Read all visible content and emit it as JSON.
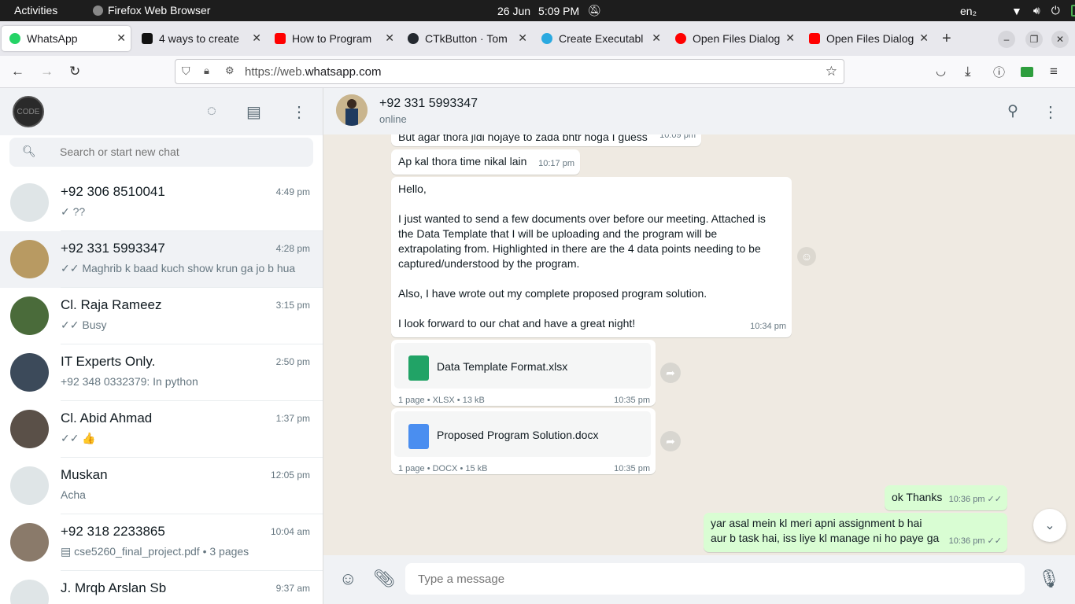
{
  "os": {
    "activities": "Activities",
    "app_name": "Firefox Web Browser",
    "date": "26 Jun",
    "time": "5:09 PM",
    "keyboard": "en₂"
  },
  "tabs": [
    {
      "title": "WhatsApp",
      "color": "#25d366"
    },
    {
      "title": "4 ways to create",
      "color": "#111111"
    },
    {
      "title": "How to Program",
      "color": "#ff0000"
    },
    {
      "title": "CTkButton · Tom",
      "color": "#24292f"
    },
    {
      "title": "Create Executabl",
      "color": "#2aa9e0"
    },
    {
      "title": "Open Files Dialog",
      "color": "#ff0000"
    },
    {
      "title": "Open Files Dialog",
      "color": "#ff0000"
    }
  ],
  "url": {
    "prefix": "https://web.",
    "domain": "whatsapp.com"
  },
  "sidebar": {
    "avatar_text": "CODE",
    "search_placeholder": "Search or start new chat",
    "chats": [
      {
        "name": "+92 306 8510041",
        "time": "4:49 pm",
        "preview": "✓ ??",
        "avatar": "#dfe5e7"
      },
      {
        "name": "+92 331 5993347",
        "time": "4:28 pm",
        "preview": "✓✓ Maghrib k baad kuch show krun ga jo b hua",
        "avatar": "#b89a62"
      },
      {
        "name": "Cl. Raja Rameez",
        "time": "3:15 pm",
        "preview": "✓✓ Busy",
        "avatar": "#4a6b3a"
      },
      {
        "name": "IT Experts Only.",
        "time": "2:50 pm",
        "preview": "+92 348 0332379: In python",
        "avatar": "#3c4a5a"
      },
      {
        "name": "Cl. Abid Ahmad",
        "time": "1:37 pm",
        "preview": "✓✓ 👍",
        "avatar": "#5a5048"
      },
      {
        "name": "Muskan",
        "time": "12:05 pm",
        "preview": "Acha",
        "avatar": "#dfe5e7"
      },
      {
        "name": "+92 318 2233865",
        "time": "10:04 am",
        "preview": "▤ cse5260_final_project.pdf • 3 pages",
        "avatar": "#8a7a6a"
      },
      {
        "name": "J. Mrqb Arslan Sb",
        "time": "9:37 am",
        "preview": "✓✓ ...",
        "avatar": "#dfe5e7"
      }
    ]
  },
  "conversation": {
    "name": "+92 331 5993347",
    "status": "online",
    "messages": {
      "m0_text": "But agar thora jldi hojaye to zada bhtr hoga I guess",
      "m0_time": "10:09 pm",
      "m1_text": "Ap kal thora time nikal lain",
      "m1_time": "10:17 pm",
      "m2_p1": "Hello,",
      "m2_p2": "I just wanted to send a few documents over before our meeting. Attached is the Data Template that I will be uploading and the program will be extrapolating from. Highlighted in there are the 4 data points needing to be captured/understood by the program.",
      "m2_p3": "Also, I have wrote out my complete proposed program solution.",
      "m2_p4": "I look forward to our chat and have a great night!",
      "m2_time": "10:34 pm",
      "f1_name": "Data Template Format.xlsx",
      "f1_meta": "1 page • XLSX • 13 kB",
      "f1_time": "10:35 pm",
      "f2_name": "Proposed Program Solution.docx",
      "f2_meta": "1 page • DOCX • 15 kB",
      "f2_time": "10:35 pm",
      "o1_text": "ok Thanks",
      "o1_time": "10:36 pm ✓✓",
      "o2_line1": "yar asal mein kl meri apni assignment b hai",
      "o2_line2": "aur b task hai, iss liye kl manage ni ho paye ga",
      "o2_time": "10:36 pm ✓✓"
    }
  },
  "composer": {
    "placeholder": "Type a message"
  }
}
